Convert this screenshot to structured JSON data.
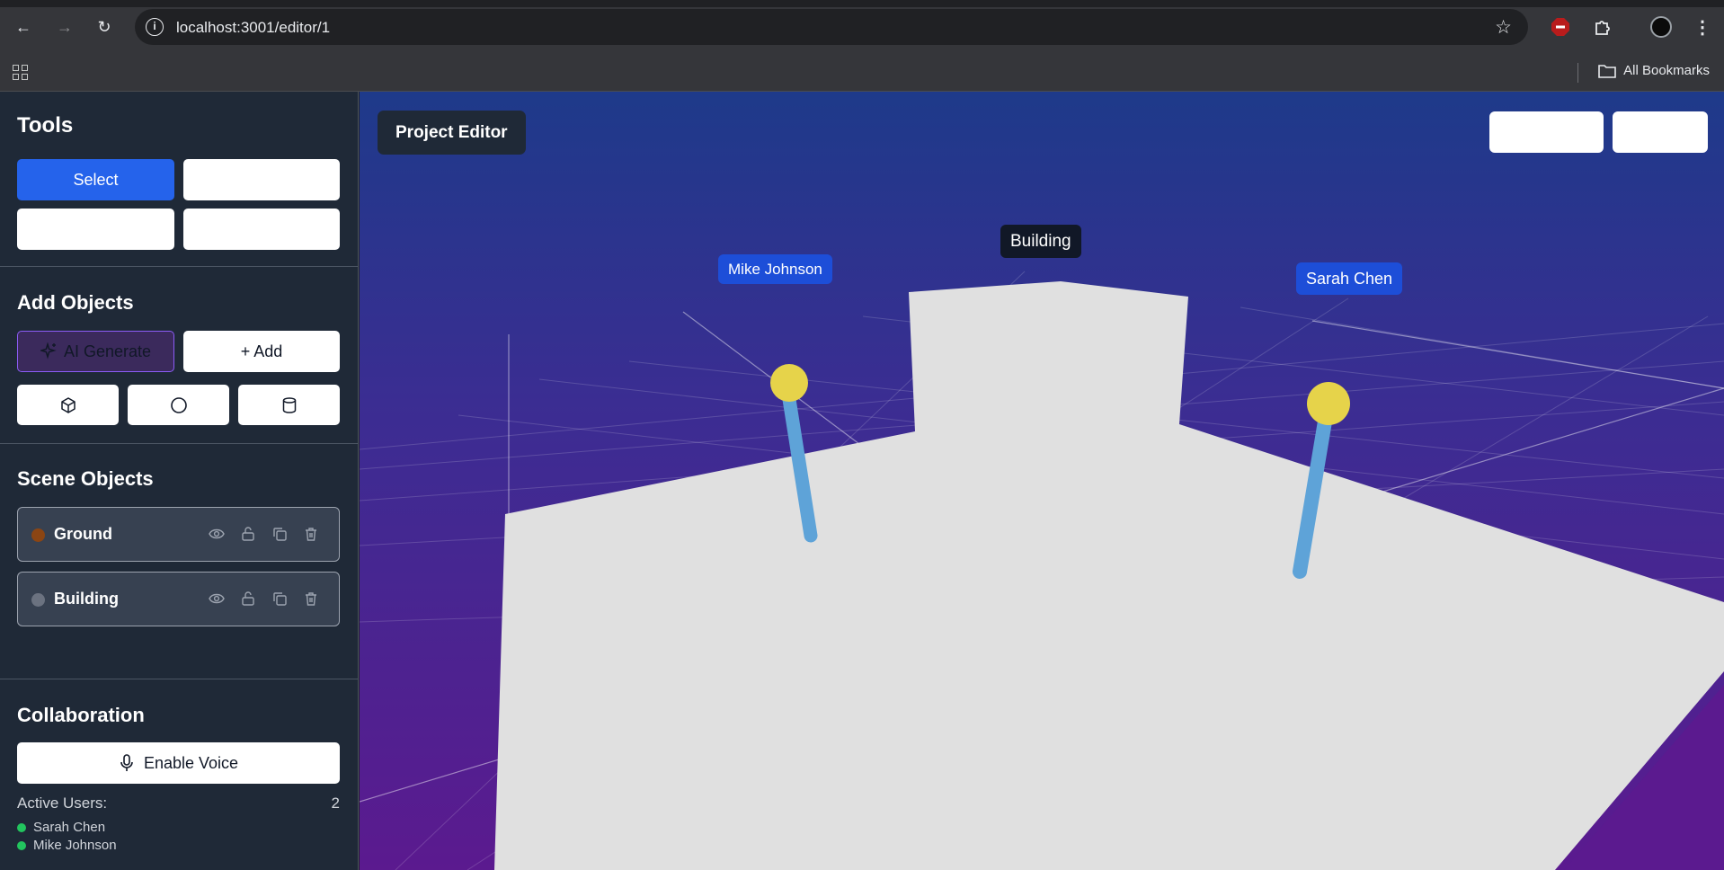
{
  "browser": {
    "url": "localhost:3001/editor/1",
    "bookmarks_label": "All Bookmarks"
  },
  "sidebar": {
    "tools": {
      "title": "Tools",
      "select_label": "Select",
      "blank_buttons": [
        "",
        "",
        ""
      ]
    },
    "add_objects": {
      "title": "Add Objects",
      "ai_generate_label": "AI Generate",
      "add_label": "+ Add",
      "shapes": [
        "cube-icon",
        "sphere-icon",
        "cylinder-icon"
      ]
    },
    "scene_objects": {
      "title": "Scene Objects",
      "items": [
        {
          "name": "Ground",
          "color": "#8b4513"
        },
        {
          "name": "Building",
          "color": "#6b7280"
        }
      ]
    },
    "collaboration": {
      "title": "Collaboration",
      "voice_label": "Enable Voice",
      "active_users_label": "Active Users:",
      "active_users_count": "2",
      "users": [
        "Sarah Chen",
        "Mike Johnson"
      ]
    }
  },
  "viewport": {
    "title": "Project Editor",
    "labels": {
      "building": "Building",
      "user_a": "Mike Johnson",
      "user_b": "Sarah Chen"
    },
    "colors": {
      "ground": "#e0e0e0",
      "avatar_head": "#e6d34a",
      "avatar_body": "#5ea3d8",
      "user_tag": "#1d4ed8"
    }
  }
}
